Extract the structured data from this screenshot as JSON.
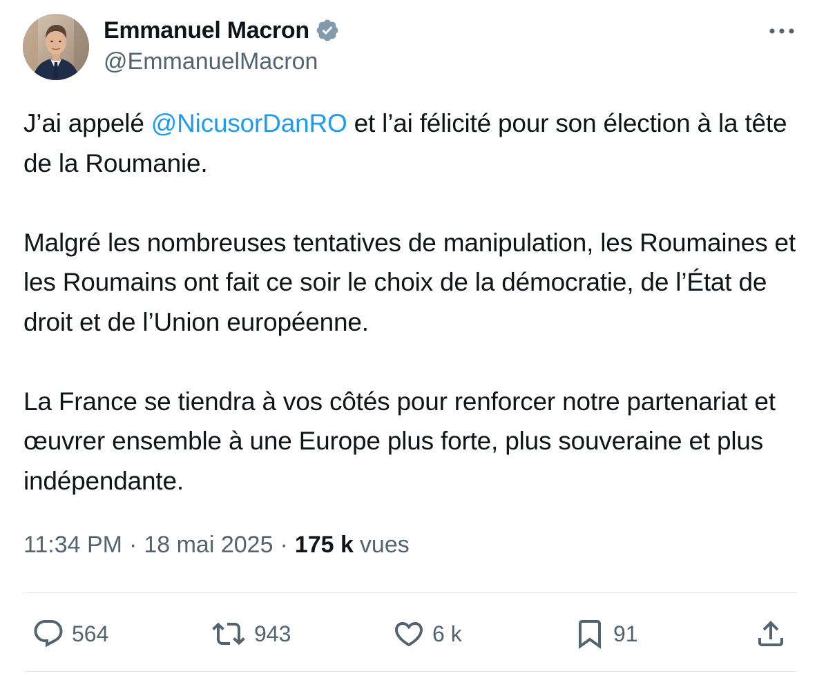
{
  "author": {
    "name": "Emmanuel Macron",
    "handle": "@EmmanuelMacron",
    "verified_icon": "verified-badge-icon"
  },
  "tweet": {
    "p1_before": "J’ai appelé ",
    "p1_mention": "@NicusorDanRO",
    "p1_after": " et l’ai félicité pour son élection à la tête de la Roumanie.",
    "p2": "Malgré les nombreuses tentatives de manipulation, les Roumaines et les Roumains ont fait ce soir le choix de la démocratie, de l’État de droit et de l’Union européenne.",
    "p3": "La France se tiendra à vos côtés pour renforcer notre partenariat et œuvrer ensemble à une Europe plus forte, plus souveraine et plus indépendante."
  },
  "meta": {
    "time": "11:34 PM",
    "sep": "·",
    "date": "18 mai 2025",
    "views_count": "175 k",
    "views_label": "vues"
  },
  "actions": {
    "replies": "564",
    "reposts": "943",
    "likes": "6 k",
    "bookmarks": "91"
  },
  "icons": {
    "reply": "reply-icon",
    "repost": "repost-icon",
    "like": "heart-icon",
    "bookmark": "bookmark-icon",
    "share": "share-icon",
    "more": "more-icon"
  },
  "colors": {
    "accent": "#1d9bf0",
    "secondary_text": "#536471",
    "primary_text": "#0f1419",
    "divider": "#e7e9ea"
  }
}
